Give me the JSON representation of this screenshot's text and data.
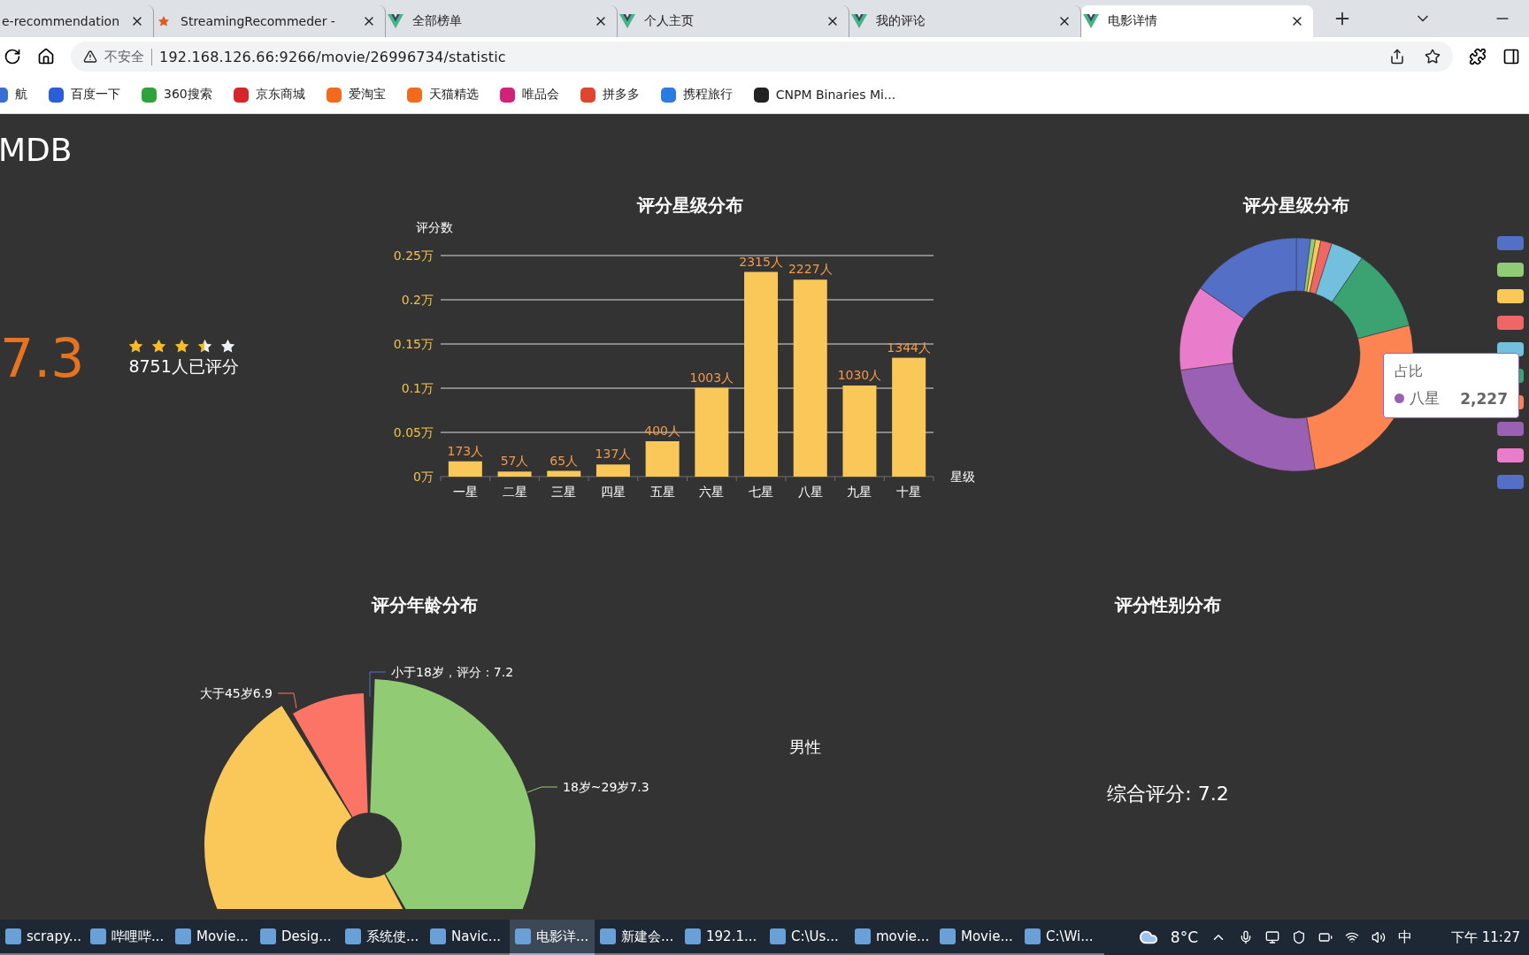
{
  "browser": {
    "tabs": [
      {
        "title": "e-recommendation",
        "selected": false
      },
      {
        "title": "StreamingRecommeder -",
        "kind": "spark",
        "selected": false
      },
      {
        "title": "全部榜单",
        "kind": "vue",
        "selected": false
      },
      {
        "title": "个人主页",
        "kind": "vue",
        "selected": false
      },
      {
        "title": "我的评论",
        "kind": "vue",
        "selected": false
      },
      {
        "title": "电影详情",
        "kind": "vue",
        "selected": true
      }
    ],
    "address": {
      "security": "不安全",
      "url": "192.168.126.66:9266/movie/26996734/statistic"
    },
    "bookmarks": [
      {
        "label": "航",
        "color": "#3b6fd8"
      },
      {
        "label": "百度一下",
        "color": "#2b5fd9"
      },
      {
        "label": "360搜索",
        "color": "#2fa33a"
      },
      {
        "label": "京东商城",
        "color": "#d7262a"
      },
      {
        "label": "爱淘宝",
        "color": "#f26b1d"
      },
      {
        "label": "天猫精选",
        "color": "#f26b1d"
      },
      {
        "label": "唯品会",
        "color": "#d0227a"
      },
      {
        "label": "拼多多",
        "color": "#e0452f"
      },
      {
        "label": "携程旅行",
        "color": "#2b7ce0"
      },
      {
        "label": "CNPM Binaries Mi...",
        "color": "#222222"
      }
    ]
  },
  "page": {
    "logo": "MDB",
    "rating": {
      "score": "7.3",
      "stars": 3.5,
      "count": "8751人已评分"
    },
    "star_chart": {
      "chart_data": {
        "type": "bar",
        "title": "评分星级分布",
        "xlabel": "星级",
        "ylabel": "评分数",
        "categories": [
          "一星",
          "二星",
          "三星",
          "四星",
          "五星",
          "六星",
          "七星",
          "八星",
          "九星",
          "十星"
        ],
        "values": [
          0.0173,
          0.0057,
          0.0065,
          0.0137,
          0.04,
          0.1003,
          0.2315,
          0.2227,
          0.103,
          0.1344
        ],
        "grid": true,
        "ylim": [
          0,
          0.25
        ],
        "yticks": [
          {
            "value": 0,
            "label": "0万"
          },
          {
            "value": 0.05,
            "label": "0.05万"
          },
          {
            "value": 0.1,
            "label": "0.1万"
          },
          {
            "value": 0.15,
            "label": "0.15万"
          },
          {
            "value": 0.2,
            "label": "0.2万"
          },
          {
            "value": 0.25,
            "label": "0.25万"
          }
        ]
      },
      "bar_labels": [
        "173人",
        "57人",
        "65人",
        "137人",
        "400人",
        "1003人",
        "2315人",
        "2227人",
        "1030人",
        "1344人"
      ]
    },
    "star_donut": {
      "title": "评分星级分布",
      "tooltip": {
        "title": "占比",
        "name": "八星",
        "value": "2,227",
        "color": "#9a60b4"
      }
    },
    "age_chart": {
      "title": "评分年龄分布",
      "labels": [
        "大于45岁6.9",
        "小于18岁，评分：7.2",
        "18岁~29岁7.3"
      ]
    },
    "gender": {
      "title": "评分性别分布",
      "label": "男性",
      "overall": "综合评分: 7.2"
    }
  },
  "taskbar": {
    "apps": [
      {
        "label": "scrapy...",
        "selected": false
      },
      {
        "label": "哔哩哔...",
        "selected": false
      },
      {
        "label": "Movie...",
        "selected": false
      },
      {
        "label": "Desig...",
        "selected": false
      },
      {
        "label": "系统使...",
        "selected": false
      },
      {
        "label": "Navic...",
        "selected": false
      },
      {
        "label": "电影详...",
        "selected": true
      },
      {
        "label": "新建会...",
        "selected": false
      },
      {
        "label": "192.1...",
        "selected": false
      },
      {
        "label": "C:\\Us...",
        "selected": false
      },
      {
        "label": "movie...",
        "selected": false
      },
      {
        "label": "Movie...",
        "selected": false
      },
      {
        "label": "C:\\Wi...",
        "selected": false
      }
    ],
    "weather": "8°C",
    "ime": "中",
    "time": "下午 11:27"
  }
}
